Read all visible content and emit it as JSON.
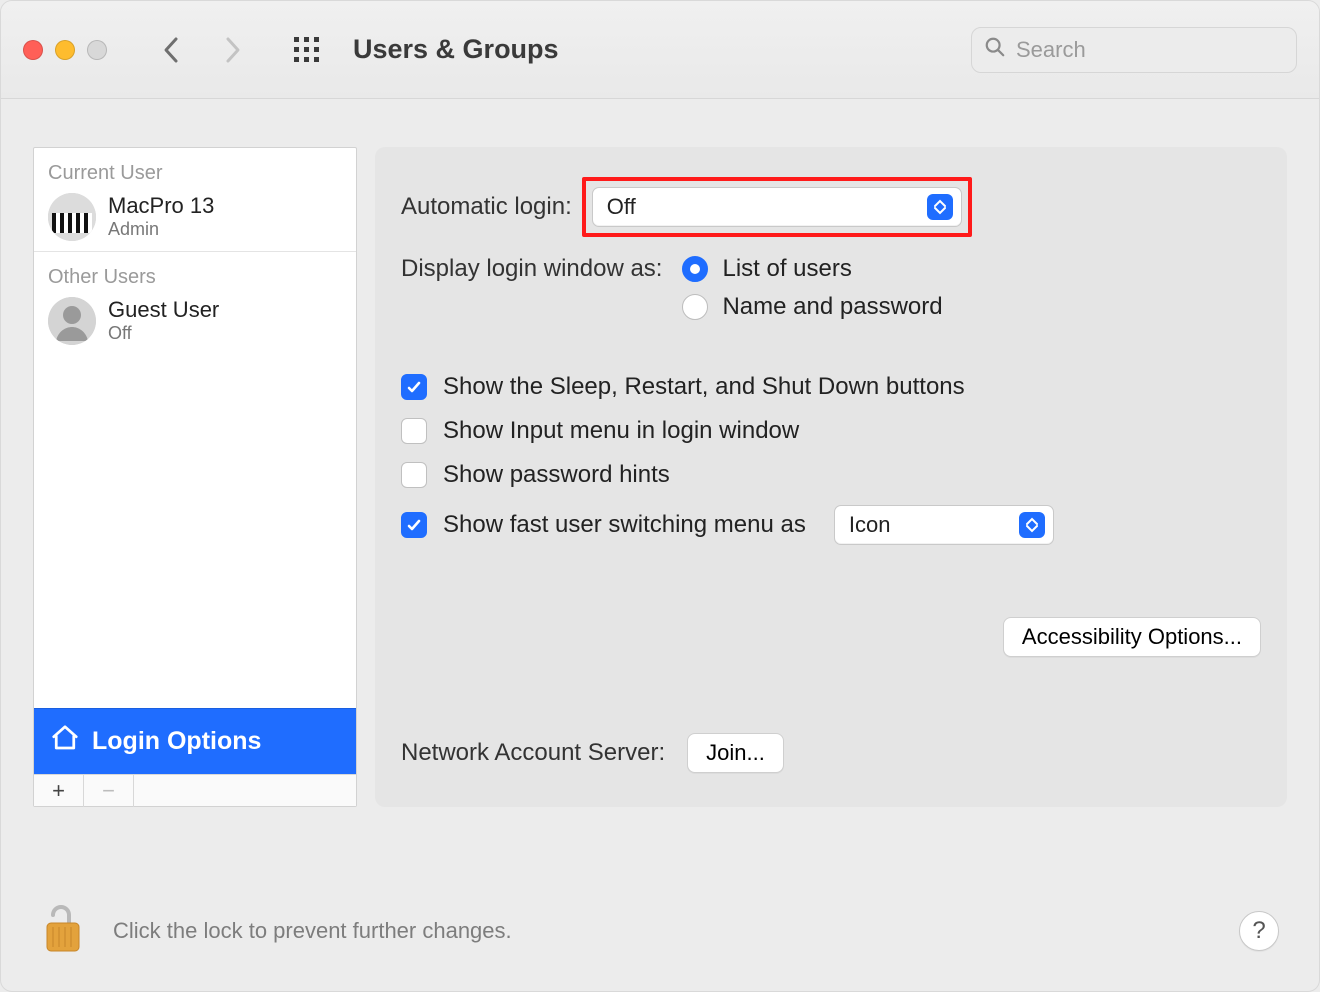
{
  "header": {
    "title": "Users & Groups",
    "search_placeholder": "Search"
  },
  "sidebar": {
    "current_label": "Current User",
    "current_user": {
      "name": "MacPro 13",
      "role": "Admin"
    },
    "other_label": "Other Users",
    "guest_user": {
      "name": "Guest User",
      "status": "Off"
    },
    "login_options_label": "Login Options"
  },
  "pane": {
    "automatic_login_label": "Automatic login:",
    "automatic_login_value": "Off",
    "display_label": "Display login window as:",
    "radio_list": "List of users",
    "radio_namepw": "Name and password",
    "chk_sleep": "Show the Sleep, Restart, and Shut Down buttons",
    "chk_input": "Show Input menu in login window",
    "chk_hints": "Show password hints",
    "chk_fastswitch": "Show fast user switching menu as",
    "fastswitch_value": "Icon",
    "accessibility_btn": "Accessibility Options...",
    "nas_label": "Network Account Server:",
    "nas_btn": "Join..."
  },
  "footer": {
    "lock_msg": "Click the lock to prevent further changes."
  },
  "state": {
    "display_selected": "list",
    "chk_sleep": true,
    "chk_input": false,
    "chk_hints": false,
    "chk_fastswitch": true
  }
}
